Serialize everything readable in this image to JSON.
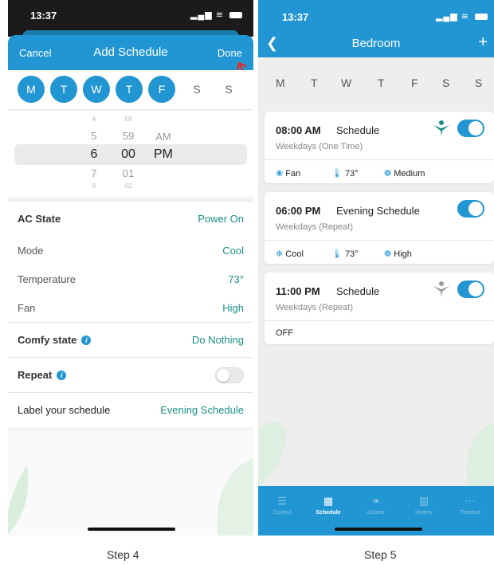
{
  "left": {
    "time": "13:37",
    "cancel": "Cancel",
    "title": "Add Schedule",
    "done": "Done",
    "days": [
      {
        "label": "M",
        "selected": true
      },
      {
        "label": "T",
        "selected": true
      },
      {
        "label": "W",
        "selected": true
      },
      {
        "label": "T",
        "selected": true
      },
      {
        "label": "F",
        "selected": true
      },
      {
        "label": "S",
        "selected": false
      },
      {
        "label": "S",
        "selected": false
      }
    ],
    "picker": {
      "hours": [
        "4",
        "5",
        "6",
        "7",
        "8"
      ],
      "minutes": [
        "58",
        "59",
        "00",
        "01",
        "02"
      ],
      "ampm": [
        "AM",
        "PM"
      ]
    },
    "ac_state": {
      "label": "AC State",
      "value": "Power On"
    },
    "mode": {
      "label": "Mode",
      "value": "Cool"
    },
    "temperature": {
      "label": "Temperature",
      "value": "73°"
    },
    "fan": {
      "label": "Fan",
      "value": "High"
    },
    "comfy": {
      "label": "Comfy state",
      "value": "Do Nothing"
    },
    "repeat": {
      "label": "Repeat",
      "enabled": false
    },
    "schedule_label": {
      "label": "Label your schedule",
      "value": "Evening Schedule"
    }
  },
  "right": {
    "time": "13:37",
    "title": "Bedroom",
    "days": [
      "M",
      "T",
      "W",
      "T",
      "F",
      "S",
      "S"
    ],
    "cards": [
      {
        "time": "08:00 AM",
        "name": "Schedule",
        "sub": "Weekdays (One Time)",
        "enabled": true,
        "items": [
          {
            "icon": "fan-icon",
            "text": "Fan"
          },
          {
            "icon": "thermometer-icon",
            "text": "73°"
          },
          {
            "icon": "fan-speed-icon",
            "text": "Medium"
          }
        ]
      },
      {
        "time": "06:00 PM",
        "name": "Evening Schedule",
        "sub": "Weekdays (Repeat)",
        "enabled": true,
        "items": [
          {
            "icon": "snowflake-icon",
            "text": "Cool"
          },
          {
            "icon": "thermometer-icon",
            "text": "73°"
          },
          {
            "icon": "fan-speed-icon",
            "text": "High"
          }
        ]
      },
      {
        "time": "11:00 PM",
        "name": "Schedule",
        "sub": "Weekdays (Repeat)",
        "enabled": true,
        "items": [
          {
            "icon": "",
            "text": "OFF"
          }
        ]
      }
    ],
    "tabs": [
      {
        "label": "Control",
        "icon": "sliders-icon",
        "active": false
      },
      {
        "label": "Schedule",
        "icon": "calendar-icon",
        "active": true
      },
      {
        "label": "eSaver",
        "icon": "leaf-icon",
        "active": false
      },
      {
        "label": "History",
        "icon": "bar-chart-icon",
        "active": false
      },
      {
        "label": "Timeline",
        "icon": "timeline-icon",
        "active": false
      }
    ]
  },
  "captions": {
    "step4": "Step 4",
    "step5": "Step 5"
  },
  "colors": {
    "accent": "#2196d3",
    "value_text": "#1a8f86",
    "arrow": "#e03030"
  }
}
